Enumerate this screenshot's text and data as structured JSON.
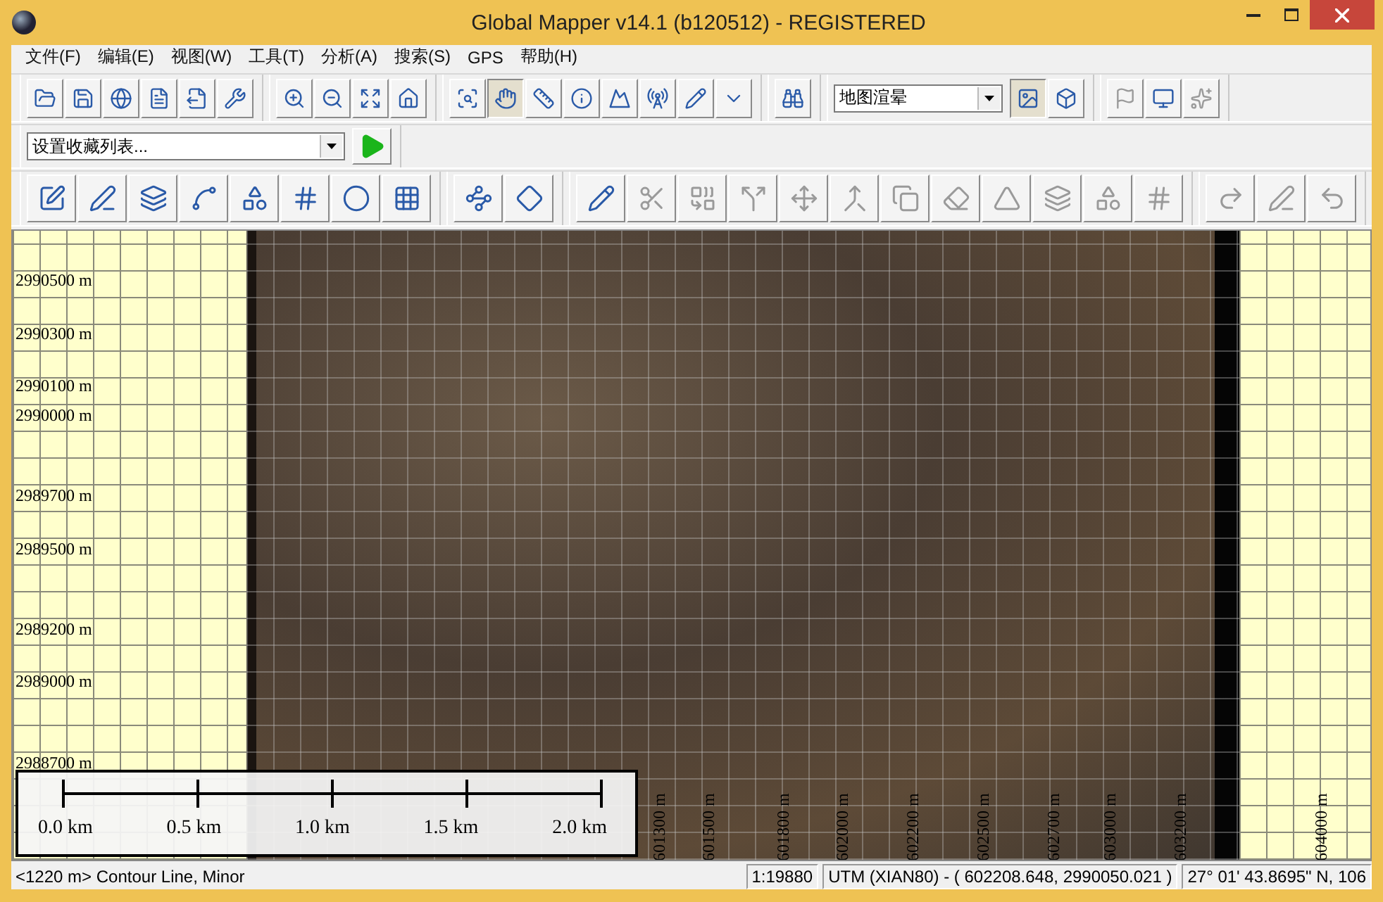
{
  "window": {
    "title": "Global Mapper v14.1 (b120512) - REGISTERED"
  },
  "menu": [
    "文件(F)",
    "编辑(E)",
    "视图(W)",
    "工具(T)",
    "分析(A)",
    "搜索(S)",
    "GPS",
    "帮助(H)"
  ],
  "toolbars": [
    {
      "groups": [
        {
          "items": [
            {
              "kind": "button",
              "pressed": false,
              "disabled": false
            },
            {
              "kind": "button",
              "pressed": false,
              "disabled": false
            },
            {
              "kind": "button",
              "pressed": false,
              "disabled": false
            },
            {
              "kind": "button",
              "pressed": false,
              "disabled": false
            },
            {
              "kind": "button",
              "pressed": false,
              "disabled": false
            },
            {
              "kind": "button",
              "pressed": false,
              "disabled": false
            }
          ]
        },
        {
          "items": [
            {
              "kind": "button",
              "pressed": false,
              "disabled": false
            },
            {
              "kind": "button",
              "pressed": false,
              "disabled": false
            },
            {
              "kind": "button",
              "pressed": false,
              "disabled": false
            },
            {
              "kind": "button",
              "pressed": false,
              "disabled": false
            }
          ]
        },
        {
          "items": [
            {
              "kind": "button",
              "pressed": false,
              "disabled": false
            },
            {
              "kind": "button",
              "pressed": true,
              "disabled": false
            },
            {
              "kind": "button",
              "pressed": false,
              "disabled": false
            },
            {
              "kind": "button",
              "pressed": false,
              "disabled": false
            },
            {
              "kind": "button",
              "pressed": false,
              "disabled": false
            },
            {
              "kind": "button",
              "pressed": false,
              "disabled": false
            },
            {
              "kind": "button",
              "pressed": false,
              "disabled": false
            },
            {
              "kind": "button",
              "pressed": false,
              "disabled": false
            }
          ]
        },
        {
          "items": [
            {
              "kind": "button",
              "pressed": false,
              "disabled": false
            }
          ]
        },
        {
          "items": [
            {
              "kind": "dropdown",
              "value": "地图渲晕"
            },
            {
              "kind": "button",
              "pressed": true,
              "disabled": false
            },
            {
              "kind": "button",
              "pressed": false,
              "disabled": false
            }
          ]
        },
        {
          "items": [
            {
              "kind": "button",
              "pressed": false,
              "disabled": true
            },
            {
              "kind": "button",
              "pressed": false,
              "disabled": false
            },
            {
              "kind": "button",
              "pressed": false,
              "disabled": true
            }
          ]
        }
      ]
    },
    {
      "groups": [
        {
          "items": [
            {
              "kind": "dropdown",
              "value": "设置收藏列表..."
            },
            {
              "kind": "button",
              "pressed": false,
              "disabled": false
            }
          ]
        }
      ]
    },
    {
      "groups": [
        {
          "items": [
            {
              "kind": "button",
              "pressed": false,
              "disabled": false
            },
            {
              "kind": "button",
              "pressed": false,
              "disabled": false
            },
            {
              "kind": "button",
              "pressed": false,
              "disabled": false
            },
            {
              "kind": "button",
              "pressed": false,
              "disabled": false
            },
            {
              "kind": "button",
              "pressed": false,
              "disabled": false
            },
            {
              "kind": "button",
              "pressed": false,
              "disabled": false
            },
            {
              "kind": "button",
              "pressed": false,
              "disabled": false
            },
            {
              "kind": "button",
              "pressed": false,
              "disabled": false
            }
          ]
        },
        {
          "items": [
            {
              "kind": "button",
              "pressed": false,
              "disabled": false
            },
            {
              "kind": "button",
              "pressed": false,
              "disabled": false
            }
          ]
        },
        {
          "items": [
            {
              "kind": "button",
              "pressed": false,
              "disabled": false
            },
            {
              "kind": "button",
              "pressed": false,
              "disabled": true
            },
            {
              "kind": "button",
              "pressed": false,
              "disabled": true
            },
            {
              "kind": "button",
              "pressed": false,
              "disabled": true
            },
            {
              "kind": "button",
              "pressed": false,
              "disabled": true
            },
            {
              "kind": "button",
              "pressed": false,
              "disabled": true
            },
            {
              "kind": "button",
              "pressed": false,
              "disabled": true
            },
            {
              "kind": "button",
              "pressed": false,
              "disabled": true
            },
            {
              "kind": "button",
              "pressed": false,
              "disabled": true
            },
            {
              "kind": "button",
              "pressed": false,
              "disabled": true
            },
            {
              "kind": "button",
              "pressed": false,
              "disabled": true
            },
            {
              "kind": "button",
              "pressed": false,
              "disabled": true
            }
          ]
        },
        {
          "items": [
            {
              "kind": "button",
              "pressed": false,
              "disabled": true
            },
            {
              "kind": "button",
              "pressed": false,
              "disabled": true
            },
            {
              "kind": "button",
              "pressed": false,
              "disabled": true
            }
          ]
        }
      ]
    }
  ],
  "map": {
    "northing_labels": [
      "2990500 m",
      "2990300 m",
      "2990100 m",
      "2990000 m",
      "2989700 m",
      "2989500 m",
      "2989200 m",
      "2989000 m",
      "2988700 m"
    ],
    "easting_labels": [
      "601300 m",
      "601500 m",
      "601800 m",
      "602000 m",
      "602200 m",
      "602500 m",
      "602700 m",
      "603000 m",
      "603200 m"
    ],
    "right_easting_label": "604000 m",
    "scale_bar": {
      "labels": [
        "0.0 km",
        "0.5 km",
        "1.0 km",
        "1.5 km",
        "2.0 km"
      ]
    }
  },
  "status_bar": {
    "message": "<1220 m> Contour Line, Minor",
    "scale": "1:19880",
    "coordinates": "UTM (XIAN80) - ( 602208.648, 2990050.021 )",
    "geographic": "27° 01' 43.8695\" N, 106"
  }
}
